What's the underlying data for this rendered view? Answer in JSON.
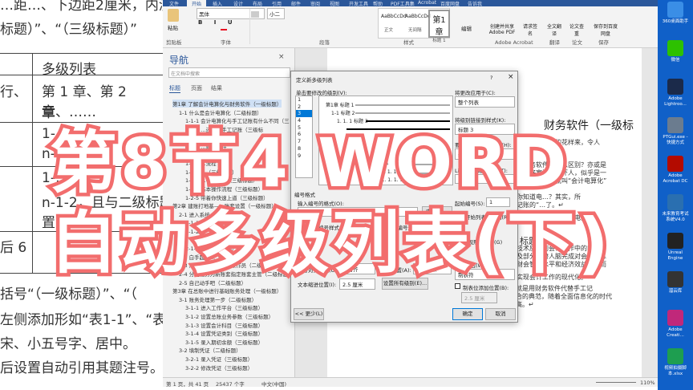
{
  "background_doc": {
    "lines_top": [
      "…距…、下边距2厘米，内测边…",
      "标题）”、“（三级标题）”"
    ],
    "table": {
      "header": "多级列表",
      "rows": [
        [
          "行、",
          "第 1 章、第 2 章、……",
          "章"
        ],
        [
          "、",
          "1-…",
          "n-1-…"
        ],
        [
          "",
          "1-…",
          "n-1-2，且与二级标题缩",
          "置…"
        ],
        [
          "后 6",
          "",
          ""
        ]
      ]
    },
    "lines_bottom": [
      "括号“（一级标题）”、“（",
      "左侧添加形如“表1-1”、“表",
      "宋、小五号字、居中。",
      "后设置自动引用其题注号。为"
    ]
  },
  "ribbon": {
    "tabs": [
      "文件",
      "开始",
      "插入",
      "设计",
      "布局",
      "引用",
      "邮件",
      "审阅",
      "视图",
      "开发工具",
      "帮助",
      "PDF工具集",
      "Acrobat",
      "百度网盘",
      "告诉我"
    ],
    "font_name": "黑体",
    "font_size": "小二",
    "paste_label": "粘贴",
    "groups": [
      "剪贴板",
      "字体",
      "段落",
      "样式",
      "Adobe Acrobat",
      "翻译",
      "论文",
      "保存"
    ],
    "styles": [
      {
        "preview": "AaBbCcDd",
        "name": "正文"
      },
      {
        "preview": "AaBbCcDd",
        "name": "无间隔"
      },
      {
        "preview": "第1章",
        "name": "标题 1"
      }
    ],
    "edit_label": "编辑",
    "buttons": [
      "创建并共享 Adobe PDF",
      "请求签名",
      "全文翻译",
      "论文查重",
      "保存到百度网盘"
    ]
  },
  "nav": {
    "title": "导航",
    "search_placeholder": "在文档中搜索",
    "tabs": [
      "标题",
      "页面",
      "结果"
    ],
    "items": [
      {
        "level": 1,
        "text": "第1章 了解会计电算化与财务软件（一级标题）"
      },
      {
        "level": 2,
        "text": "1-1 什么是会计电算化（二级标题）"
      },
      {
        "level": 3,
        "text": "1-1-1 会计电算化与手工记账有什么不同（三"
      },
      {
        "level": 3,
        "text": "1-1-2 …还需要手工记账（三级标"
      },
      {
        "level": 3,
        "text": "1-1-3 …的难题"
      },
      {
        "level": 3,
        "text": "1-1-4 …财务软件"
      },
      {
        "level": 2,
        "text": "1-2 …（二级标题）"
      },
      {
        "level": 3,
        "text": "1-2-1 …流程"
      },
      {
        "level": 3,
        "text": "1-2-2 …（三级标题）"
      },
      {
        "level": 3,
        "text": "1-2-3 …导与系统（三级标题）"
      },
      {
        "level": 3,
        "text": "1-2-4 基本操作流程（三级标题）"
      },
      {
        "level": 3,
        "text": "1-2-5 带着你快速上道（三级标题）"
      },
      {
        "level": 1,
        "text": "第2章 建账打地基——账套设置（一级标题）"
      },
      {
        "level": 2,
        "text": "2-1 进入系统…"
      },
      {
        "level": 3,
        "text": "2-1-1 …（三级标题）"
      },
      {
        "level": 3,
        "text": "2-1-2 …（三级标题）"
      },
      {
        "level": 3,
        "text": "2-1-3 …"
      },
      {
        "level": 3,
        "text": "2-1-4 …（三级标题）"
      },
      {
        "level": 2,
        "text": "2-2 白手起家…（二级标题）"
      },
      {
        "level": 2,
        "text": "2-3 添丁进口——增加操作员（二级标题）"
      },
      {
        "level": 2,
        "text": "2-4 分配任务为新账套指定账套主管（二级标题）"
      },
      {
        "level": 2,
        "text": "2-5 自己动手吧（二级标题）"
      },
      {
        "level": 1,
        "text": "第3章 在总账中进行基础账务处理（一级标题）"
      },
      {
        "level": 2,
        "text": "3-1 账务处理第一步（二级标题）"
      },
      {
        "level": 3,
        "text": "3-1-1 进入工作平台（三级标题）"
      },
      {
        "level": 3,
        "text": "3-1-2 设置总账业务参数（三级标题）"
      },
      {
        "level": 3,
        "text": "3-1-3 设置会计科目（三级标题）"
      },
      {
        "level": 3,
        "text": "3-1-4 设置凭证类别（三级标题）"
      },
      {
        "level": 3,
        "text": "3-1-5 录入期初余额（三级标题）"
      },
      {
        "level": 2,
        "text": "3-2 填制凭证（二级标题）"
      },
      {
        "level": 3,
        "text": "3-2-1 录入凭证（三级标题）"
      },
      {
        "level": 3,
        "text": "3-2-2 修改凭证（三级标题）"
      }
    ]
  },
  "page": {
    "heading": "财务软件（一级标",
    "lines": [
      "天就会变…新的花样来，令人",
      "和财务软件有什么区别？亦或是",
      "大、好宽泛、好吓人，似乎是一",
      "时有一门功课就叫“会计电算化”",
      "你知道电…？其实，所",
      "记账的“…了。↵",
      "始，快速…一个会计电算",
      "标题）↵",
      "技术应用到会计工作中的简称，",
      "及部分代替人脑完成对会计信息",
      "财会管理水平和经济效益，从而",
      "实现会计工作的现代化。↵",
      "目前已经时髦的叫会计信息系统，其实说白了就是用财务软件代替手工记",
      "账而已。会计电算化也是当前工业与信息化融合的典范，随着全面信息化的时代",
      "前进，会计的电算化、信息化程度也会越来越高。↵"
    ]
  },
  "dialog": {
    "title": "定义新多级列表",
    "help": "?",
    "close": "×",
    "level_label": "单击要修改的级别(V):",
    "levels": [
      "1",
      "2",
      "3",
      "4",
      "5",
      "6",
      "7",
      "8",
      "9"
    ],
    "selected_level": "3",
    "preview": [
      "第1章 标题 1",
      "1-1 标题 2",
      "1. 1. 1 标题 3",
      "1. 1. 1. 1",
      "1. 1. 1. 1. 1",
      "1. 1. 1. 1. 1. 1"
    ],
    "apply_to_label": "将更改应用于(C):",
    "apply_to_value": "整个列表",
    "link_style_label": "将级别链接到样式(K):",
    "link_style_value": "标题 3",
    "gallery_label": "要在库中显示的级别(H):",
    "gallery_value": "级别 1",
    "listnum_label": "ListNum 域列表名(T):",
    "number_format_section": "编号格式",
    "input_format_label": "输入编号的格式(O):",
    "input_format_value": "1-1-1",
    "font_button": "字体(F)...",
    "number_style_label": "此级别的编号样式(N):",
    "include_level_label": "包含的级别编号来自(D):",
    "start_at_label": "起始编号(S):",
    "start_at_value": "1",
    "restart_label": "重新开始列表的间隔(R):",
    "legal_label": "正规形式编号(G)",
    "position_section": "位置",
    "alignment_label": "编号对齐方式(U):",
    "alignment_value": "左对齐",
    "align_at_label": "对齐位置(A):",
    "align_at_value": "1.5 厘米",
    "indent_label": "文本缩进位置(I):",
    "indent_value": "2.5 厘米",
    "set_all_button": "设置所有级别(E)...",
    "follow_label": "编号之后(W):",
    "follow_value": "制表符",
    "tab_stop_label": "制表位添加位置(B):",
    "tab_stop_value": "2.5 厘米",
    "tab_stop_checked": false,
    "less_button": "<< 更少(L)",
    "ok_button": "确定",
    "cancel_button": "取消"
  },
  "status": {
    "page": "第 1 页，共 41 页",
    "words": "25437 个字",
    "language": "中文(中国)",
    "zoom": "110%"
  },
  "desktop": {
    "icons": [
      "360桌面助手",
      "微信",
      "Adobe Lightroo...",
      "PTGui.exe - 快捷方式",
      "Adobe Acrobat DC",
      "未来教育考试系统V4.0",
      "Unreal Engine",
      "溜云库",
      "Adobe Creati...",
      "视频拍摄脚本.xlsx"
    ]
  },
  "overlay": {
    "line1": "第8节4 WORD",
    "line2": "自动多级列表(下)"
  },
  "colors": {
    "word_blue": "#2b579a",
    "overlay_stroke": "#f26d6d",
    "desktop_blue": "#1060c8",
    "selection": "#0078d7"
  }
}
